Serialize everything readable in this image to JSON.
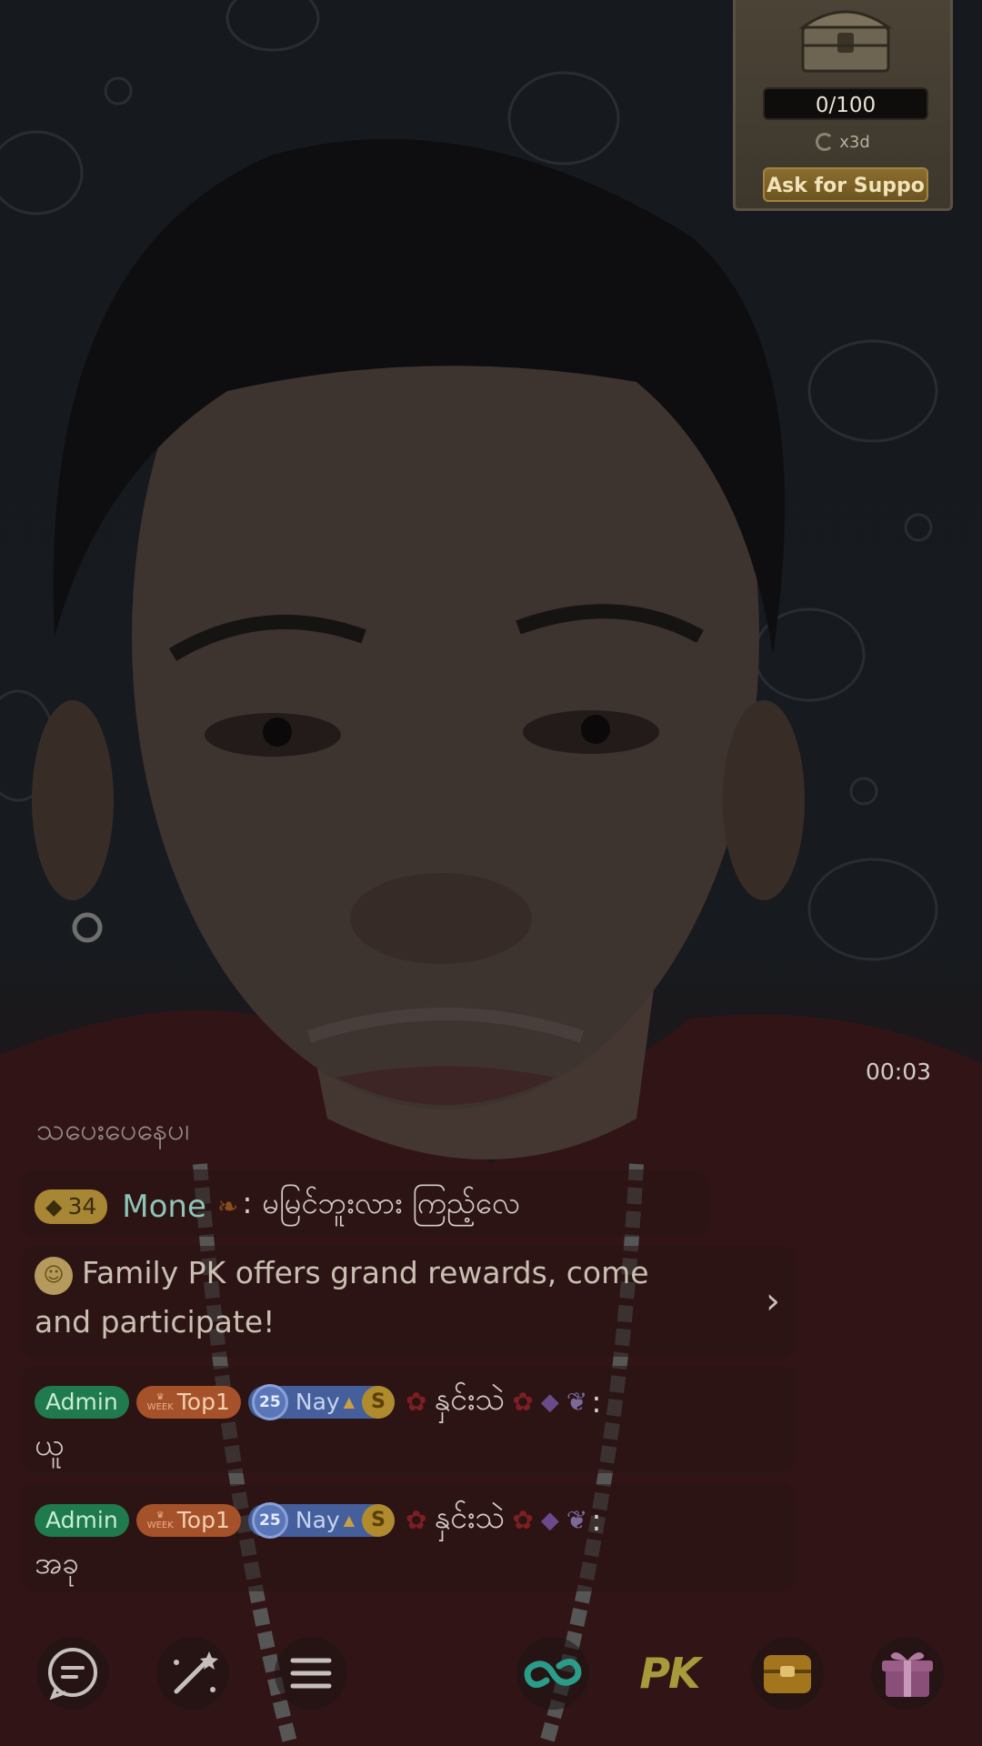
{
  "stream": {
    "duration": "00:03"
  },
  "treasure": {
    "progress": "0/100",
    "multiplier": "x3d",
    "support_label": "Ask for Suppo"
  },
  "chat": {
    "cut_text": "သပေးပေနေပါ",
    "mone": {
      "level": "34",
      "name": "Mone",
      "text": ": မမြင်ဘူးလား ကြည့်လေ"
    },
    "family_notice": {
      "line1": "Family PK offers grand rewards, come",
      "line2": "and participate!"
    },
    "messages": [
      {
        "badge_admin": "Admin",
        "badge_week": "WEEK",
        "badge_top": "Top1",
        "level": "25",
        "name": "Nay",
        "s": "S",
        "sender": "နှင်းသဲ",
        "text": "ယူ"
      },
      {
        "badge_admin": "Admin",
        "badge_week": "WEEK",
        "badge_top": "Top1",
        "level": "25",
        "name": "Nay",
        "s": "S",
        "sender": "နှင်းသဲ",
        "text": "အခု"
      }
    ]
  },
  "bottom_bar": {
    "pk_label": "PK"
  },
  "colors": {
    "admin": "#1f7a4d",
    "top1": "#a5512a",
    "nay": "#455f9c",
    "accent_link": "#2a9c8a",
    "pk": "#a69a3a"
  }
}
